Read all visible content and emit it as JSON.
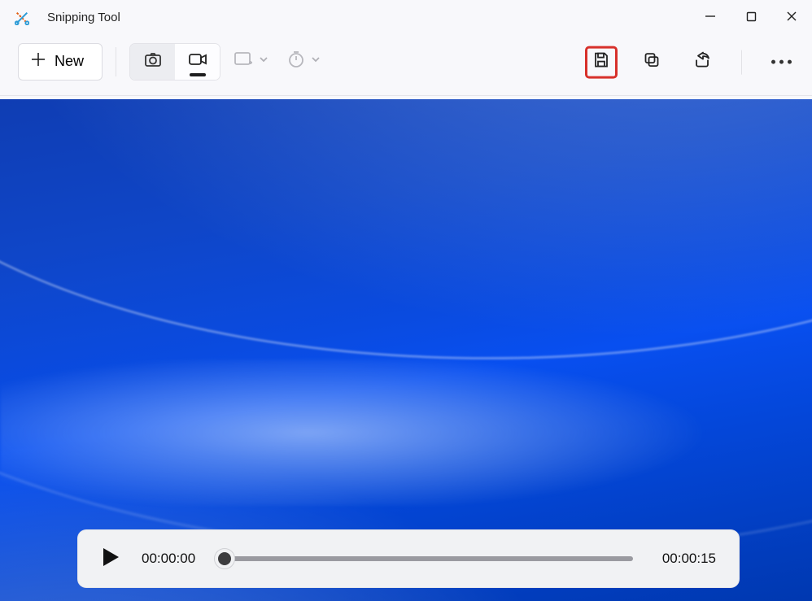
{
  "app": {
    "title": "Snipping Tool"
  },
  "toolbar": {
    "new_label": "New"
  },
  "playback": {
    "position": "00:00:00",
    "duration": "00:00:15",
    "progress_pct": 0
  },
  "icons": {
    "save": "save-icon",
    "copy": "copy-icon",
    "share": "share-icon",
    "more": "more-icon",
    "camera": "camera-icon",
    "video": "video-icon",
    "shape": "rect-shape-icon",
    "timer": "timer-icon",
    "plus": "plus-icon",
    "play": "play-icon"
  },
  "colors": {
    "accent_highlight": "#d7302a",
    "video_bg_top": "#0f3db3",
    "video_bg_bottom": "#0038b0"
  }
}
